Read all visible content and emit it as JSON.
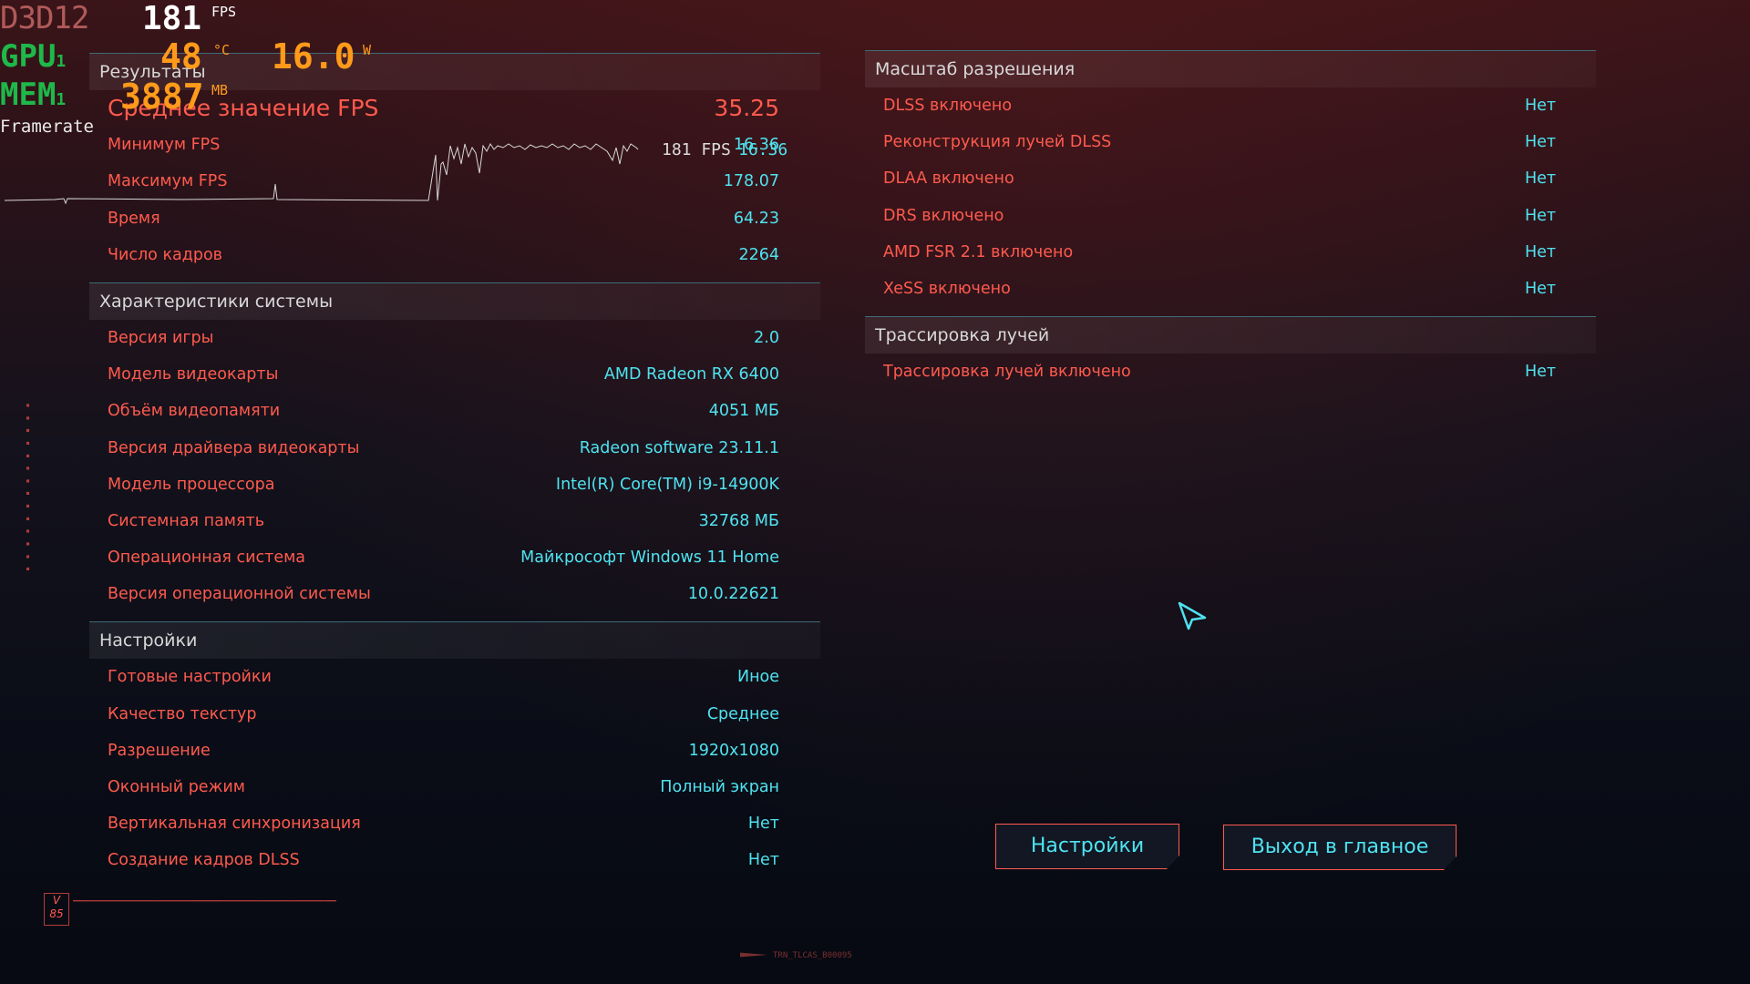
{
  "hud": {
    "api": "D3D12",
    "fps_value": "181",
    "fps_unit": "FPS",
    "gpu_label": "GPU",
    "gpu_label_sub": "1",
    "gpu_temp": "48",
    "gpu_temp_unit": "°C",
    "gpu_power": "16.0",
    "gpu_power_unit": "W",
    "mem_label": "MEM",
    "mem_label_sub": "1",
    "mem_value": "3887",
    "mem_unit": "MB",
    "framerate_label": "Framerate",
    "graph_fps": "181 FPS",
    "graph_ms": "16.36"
  },
  "results": {
    "header": "Результаты",
    "avg_fps": {
      "label": "Среднее значение FPS",
      "value": "35.25"
    },
    "rows": [
      {
        "label": "Минимум FPS",
        "value": "16.36"
      },
      {
        "label": "Максимум FPS",
        "value": "178.07"
      },
      {
        "label": "Время",
        "value": "64.23"
      },
      {
        "label": "Число кадров",
        "value": "2264"
      }
    ]
  },
  "system": {
    "header": "Характеристики системы",
    "rows": [
      {
        "label": "Версия игры",
        "value": "2.0"
      },
      {
        "label": "Модель видеокарты",
        "value": "AMD Radeon RX 6400"
      },
      {
        "label": "Объём видеопамяти",
        "value": "4051 МБ"
      },
      {
        "label": "Версия драйвера видеокарты",
        "value": "Radeon software 23.11.1"
      },
      {
        "label": "Модель процессора",
        "value": "Intel(R) Core(TM) i9-14900K"
      },
      {
        "label": "Системная память",
        "value": "32768 МБ"
      },
      {
        "label": "Операционная система",
        "value": "Майкрософт Windows 11 Home"
      },
      {
        "label": "Версия операционной системы",
        "value": "10.0.22621"
      }
    ]
  },
  "settings": {
    "header": "Настройки",
    "rows": [
      {
        "label": "Готовые настройки",
        "value": "Иное"
      },
      {
        "label": "Качество текстур",
        "value": "Среднее"
      },
      {
        "label": "Разрешение",
        "value": "1920x1080"
      },
      {
        "label": "Оконный режим",
        "value": "Полный экран"
      },
      {
        "label": "Вертикальная синхронизация",
        "value": "Нет"
      },
      {
        "label": "Создание кадров DLSS",
        "value": "Нет"
      }
    ]
  },
  "scaling": {
    "header": "Масштаб разрешения",
    "rows": [
      {
        "label": "DLSS включено",
        "value": "Нет"
      },
      {
        "label": "Реконструкция лучей DLSS",
        "value": "Нет"
      },
      {
        "label": "DLAA включено",
        "value": "Нет"
      },
      {
        "label": "DRS включено",
        "value": "Нет"
      },
      {
        "label": "AMD FSR 2.1 включено",
        "value": "Нет"
      },
      {
        "label": "XeSS включено",
        "value": "Нет"
      }
    ]
  },
  "raytracing": {
    "header": "Трассировка лучей",
    "rows": [
      {
        "label": "Трассировка лучей включено",
        "value": "Нет"
      }
    ]
  },
  "buttons": {
    "settings": "Настройки",
    "exit": "Выход в главное меню"
  },
  "decor": {
    "badge": "V 85",
    "build_id": "TRN_TLCAS_B00095"
  },
  "colors": {
    "label": "#ff5a4d",
    "value": "#4fe3f0",
    "header_text": "#d8d8d8",
    "hud_green": "#1fb84a",
    "hud_orange": "#ff9a1a"
  }
}
